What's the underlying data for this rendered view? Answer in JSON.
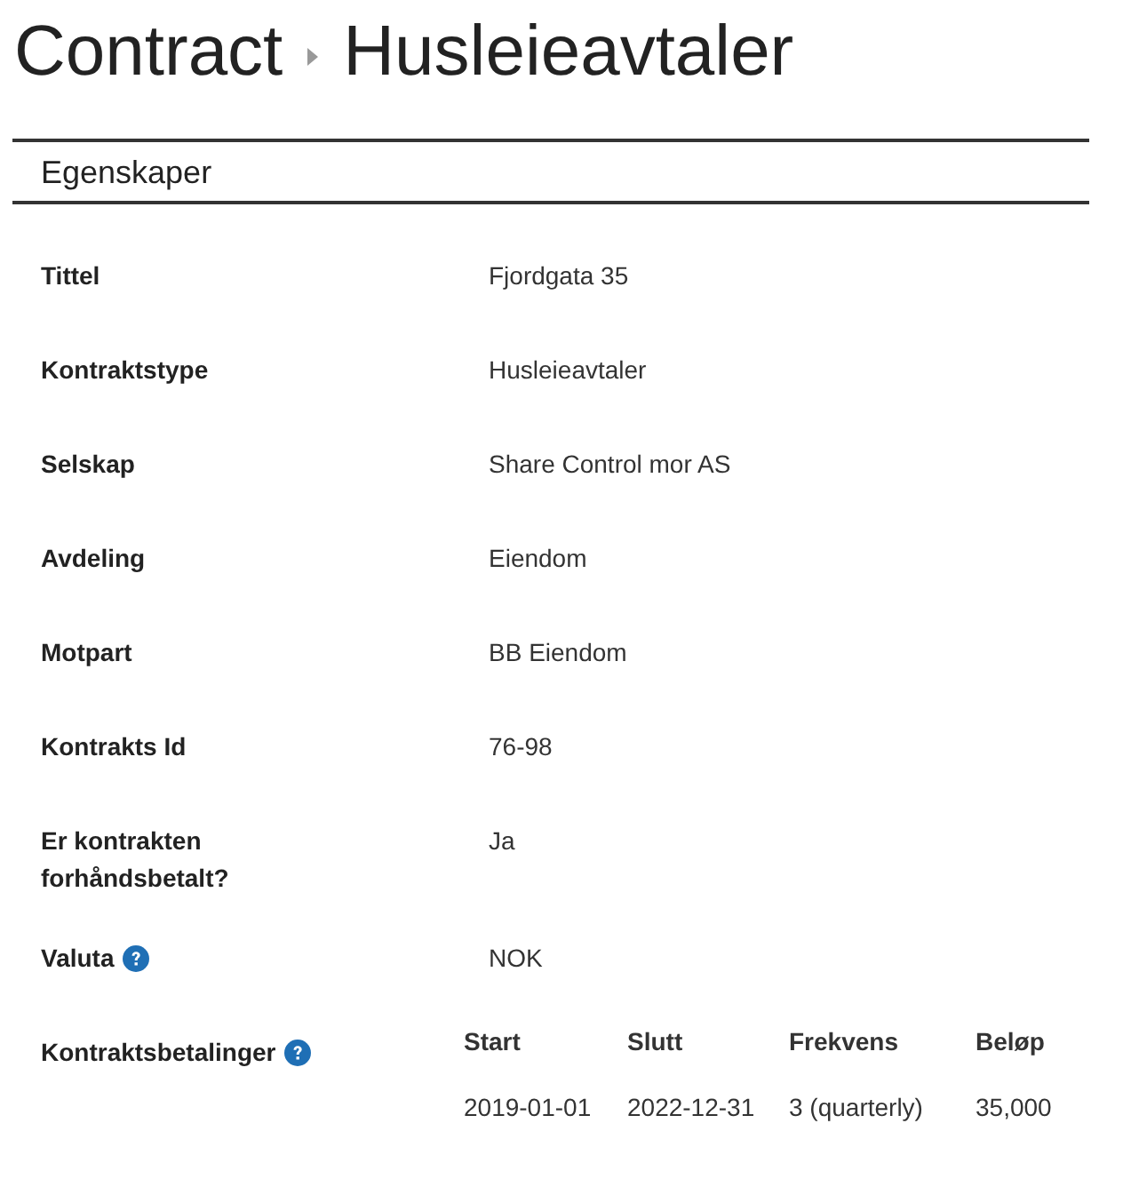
{
  "breadcrumb": [
    "Contract",
    "Husleieavtaler"
  ],
  "section": {
    "title": "Egenskaper"
  },
  "properties": [
    {
      "label": "Tittel",
      "value": "Fjordgata 35",
      "help": false
    },
    {
      "label": "Kontraktstype",
      "value": "Husleieavtaler",
      "help": false
    },
    {
      "label": "Selskap",
      "value": "Share Control mor AS",
      "help": false
    },
    {
      "label": "Avdeling",
      "value": "Eiendom",
      "help": false
    },
    {
      "label": "Motpart",
      "value": "BB Eiendom",
      "help": false
    },
    {
      "label": "Kontrakts Id",
      "value": "76-98",
      "help": false
    },
    {
      "label": "Er kontrakten forhåndsbetalt?",
      "value": "Ja",
      "help": false
    },
    {
      "label": "Valuta",
      "value": "NOK",
      "help": true
    }
  ],
  "payments": {
    "label": "Kontraktsbetalinger",
    "help": true,
    "columns": [
      "Start",
      "Slutt",
      "Frekvens",
      "Beløp"
    ],
    "rows": [
      [
        "2019-01-01",
        "2022-12-31",
        "3 (quarterly)",
        "35,000"
      ]
    ]
  }
}
